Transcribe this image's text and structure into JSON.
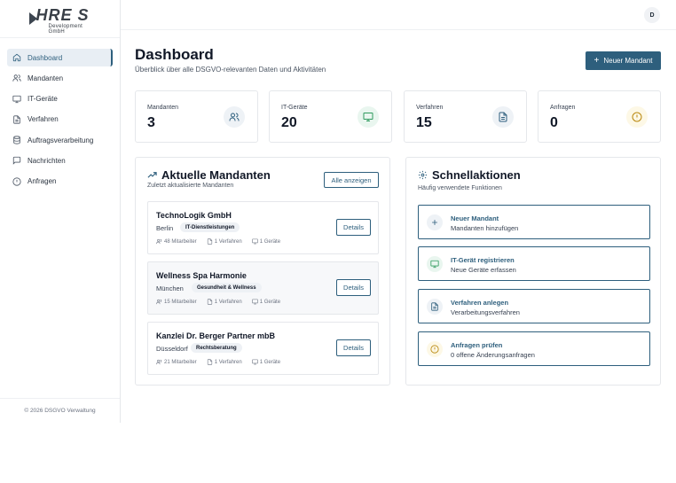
{
  "logo": {
    "main": "HRE S",
    "sub": "Development GmbH"
  },
  "sidebar": {
    "items": [
      {
        "label": "Dashboard",
        "icon": "home-icon",
        "active": true
      },
      {
        "label": "Mandanten",
        "icon": "users-icon"
      },
      {
        "label": "IT-Geräte",
        "icon": "monitor-icon"
      },
      {
        "label": "Verfahren",
        "icon": "file-icon"
      },
      {
        "label": "Auftragsverarbeitung",
        "icon": "database-icon"
      },
      {
        "label": "Nachrichten",
        "icon": "message-icon"
      },
      {
        "label": "Anfragen",
        "icon": "alert-circle-icon"
      }
    ],
    "footer": "© 2026 DSGVO Verwaltung"
  },
  "topbar": {
    "avatar": "D"
  },
  "header": {
    "title": "Dashboard",
    "subtitle": "Überblick über alle DSGVO-relevanten Daten und Aktivitäten",
    "new_button": "Neuer Mandant"
  },
  "stats": [
    {
      "label": "Mandanten",
      "value": "3",
      "icon": "users-icon",
      "color": "#eef2f6"
    },
    {
      "label": "IT-Geräte",
      "value": "20",
      "icon": "monitor-icon",
      "color": "#e9f6ef"
    },
    {
      "label": "Verfahren",
      "value": "15",
      "icon": "file-icon",
      "color": "#eef2f6"
    },
    {
      "label": "Anfragen",
      "value": "0",
      "icon": "alert-circle-icon",
      "color": "#fdf8e6"
    }
  ],
  "clients_panel": {
    "title": "Aktuelle Mandanten",
    "subtitle": "Zuletzt aktualisierte Mandanten",
    "show_all": "Alle anzeigen",
    "details_label": "Details",
    "clients": [
      {
        "name": "TechnoLogik GmbH",
        "city": "Berlin",
        "tag": "IT-Dienstleistungen",
        "employees": "48 Mitarbeiter",
        "procedures": "1 Verfahren",
        "devices": "1 Geräte"
      },
      {
        "name": "Wellness Spa Harmonie",
        "city": "München",
        "tag": "Gesundheit & Wellness",
        "employees": "15 Mitarbeiter",
        "procedures": "1 Verfahren",
        "devices": "1 Geräte"
      },
      {
        "name": "Kanzlei Dr. Berger Partner mbB",
        "city": "Düsseldorf",
        "tag": "Rechtsberatung",
        "employees": "21 Mitarbeiter",
        "procedures": "1 Verfahren",
        "devices": "1 Geräte"
      }
    ]
  },
  "quick_panel": {
    "title": "Schnellaktionen",
    "subtitle": "Häufig verwendete Funktionen",
    "actions": [
      {
        "title": "Neuer Mandant",
        "desc": "Mandanten hinzufügen",
        "icon": "plus-icon",
        "color": "#eef2f6"
      },
      {
        "title": "IT-Gerät registrieren",
        "desc": "Neue Geräte erfassen",
        "icon": "monitor-icon",
        "color": "#e9f6ef"
      },
      {
        "title": "Verfahren anlegen",
        "desc": "Verarbeitungsverfahren",
        "icon": "file-icon",
        "color": "#eef2f6"
      },
      {
        "title": "Anfragen prüfen",
        "desc": "0 offene Änderungsanfragen",
        "icon": "alert-circle-icon",
        "color": "#fdf8e6"
      }
    ]
  },
  "colors": {
    "primary": "#2e5f7d",
    "green": "#2f9a5e",
    "amber": "#b8860b"
  }
}
